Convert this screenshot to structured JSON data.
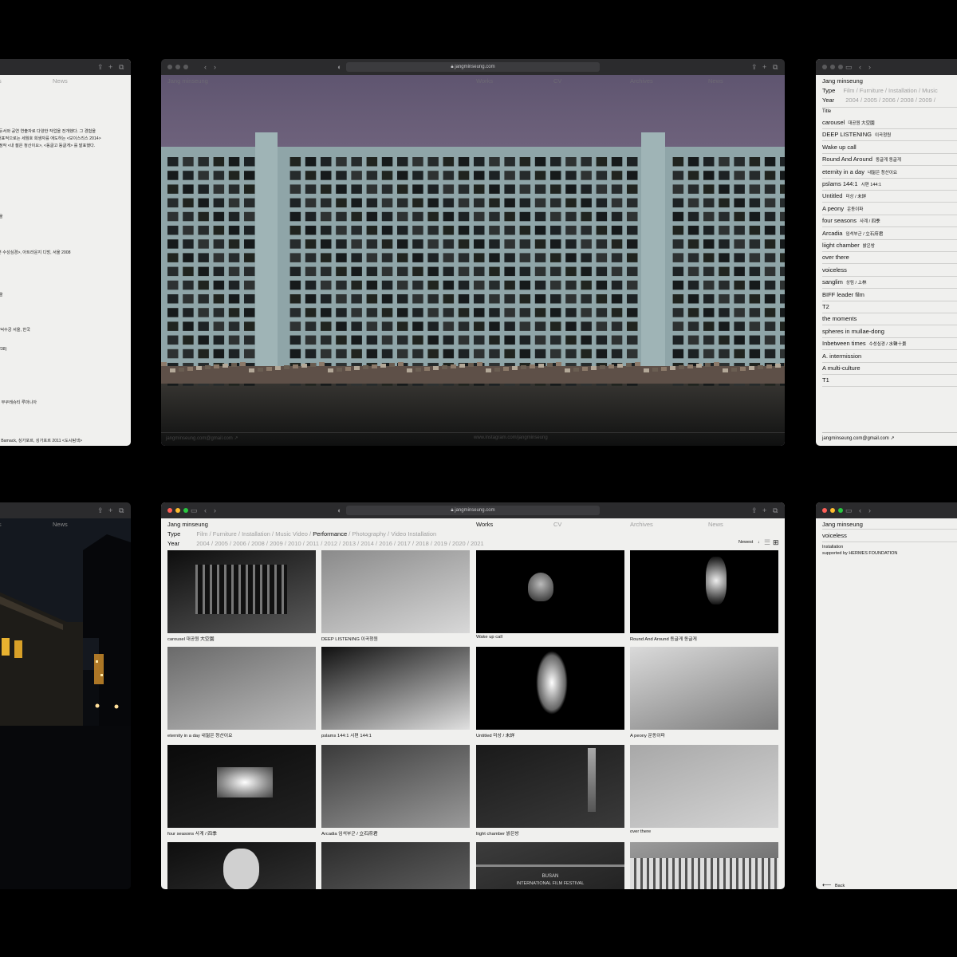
{
  "win_about": {
    "nav": [
      "s",
      "News"
    ],
    "paragraphs": [
      "로듀서와 공연 연출자로 다양한 작업을 전개했다. 그 경험을",
      ". 대표적으로는 세월호 희생자를 애도하는 <보이스리스 2014>",
      "현정작 <내 젊은 청산이요>, <동글고 동글게> 를 발표했다."
    ],
    "items": [
      "서울",
      "을",
      "+뿐 수성심경>, 아트라운지 디방, 서울 2008",
      "서울",
      "국",
      "관 덕수궁 서울, 한국",
      "s 238)",
      "관, 부쿠레슈티 루마니아",
      "국",
      "an Bamack, 싱가포르, 싱가포르 2011 <도시탐색>"
    ]
  },
  "win_photo": {
    "url": "jangminseung.com",
    "overlay_left": "Jang minseung",
    "overlay_menu": [
      "Works",
      "CV",
      "Archives",
      "News"
    ],
    "footer_email": "jangminseung.com@gmail.com ↗",
    "footer_insta": "www.instagram.com/jangminseung"
  },
  "win_list": {
    "name": "Jang minseung",
    "type_label": "Type",
    "type_values": "Film / Furniture / Installation / Music",
    "year_label": "Year",
    "year_values": "2004 / 2005 / 2006 / 2008 / 2009 /",
    "title_header": "Title",
    "rows": [
      {
        "en": "carousel",
        "ko": "대공원 大空園"
      },
      {
        "en": "DEEP LISTENING",
        "ko": "이곡청원"
      },
      {
        "en": "Wake up call",
        "ko": ""
      },
      {
        "en": "Round And Around",
        "ko": "동글게 동글게"
      },
      {
        "en": "eternity in a day",
        "ko": "내젊은 청산이요"
      },
      {
        "en": "pslams 144:1",
        "ko": "시편 144:1"
      },
      {
        "en": "Untitled",
        "ko": "미상 / 未詳"
      },
      {
        "en": "A peony",
        "ko": "운동이파"
      },
      {
        "en": "four seasons",
        "ko": "사계 / 四季"
      },
      {
        "en": "Arcadia",
        "ko": "임석부군 / 立石府君"
      },
      {
        "en": "liight chamber",
        "ko": "밝은방"
      },
      {
        "en": "over there",
        "ko": ""
      },
      {
        "en": "voiceless",
        "ko": ""
      },
      {
        "en": "sanglim",
        "ko": "상림 / 上林"
      },
      {
        "en": "BIFF leader film",
        "ko": ""
      },
      {
        "en": "T2",
        "ko": ""
      },
      {
        "en": "the moments",
        "ko": ""
      },
      {
        "en": "spheres in mullae-dong",
        "ko": ""
      },
      {
        "en": "Inbetween times",
        "ko": "수성심경 / 水聲十景"
      },
      {
        "en": "A. intermission",
        "ko": ""
      },
      {
        "en": "A multi-culture",
        "ko": ""
      },
      {
        "en": "T1",
        "ko": ""
      }
    ],
    "footer_email": "jangminseung.com@gmail.com ↗"
  },
  "win_night": {
    "nav": [
      "s",
      "News"
    ]
  },
  "win_grid": {
    "url": "jangminseung.com",
    "name": "Jang minseung",
    "menu": [
      "Works",
      "CV",
      "Archives",
      "News"
    ],
    "type_label": "Type",
    "type_values": [
      "Film",
      "Furniture",
      "Installation",
      "Music Video",
      "Performance",
      "Photography",
      "Video Installation"
    ],
    "type_selected": "Performance",
    "year_label": "Year",
    "years": [
      "2004",
      "2005",
      "2006",
      "2008",
      "2009",
      "2010",
      "2011",
      "2012",
      "2013",
      "2014",
      "2016",
      "2017",
      "2018",
      "2019",
      "2020",
      "2021"
    ],
    "sort_label": "Newest",
    "tiles": [
      "carousel 대공원 大空園",
      "DEEP LISTENING 이곡청원",
      "Wake up call",
      "Round And Around 동글게 동글게",
      "eternity in a day 내젊은 청산이요",
      "pslams 144:1 시편 144:1",
      "Untitled 미상 / 未詳",
      "A peony 운동이파",
      "four seasons 사계 / 四季",
      "Arcadia 임석부군 / 立石府君",
      "liight chamber 밝은방",
      "over there"
    ],
    "biff_text": [
      "BUSAN",
      "INTERNATIONAL FILM FESTIVAL"
    ]
  },
  "win_detail": {
    "name": "Jang minseung",
    "title": "voiceless",
    "type": "Installation",
    "support": "supported by HERMES FOUNDATION",
    "back": "Back"
  },
  "colors": {
    "background": "#000000",
    "window_bg": "#f0f0ee",
    "chrome": "#2b2b2d"
  }
}
